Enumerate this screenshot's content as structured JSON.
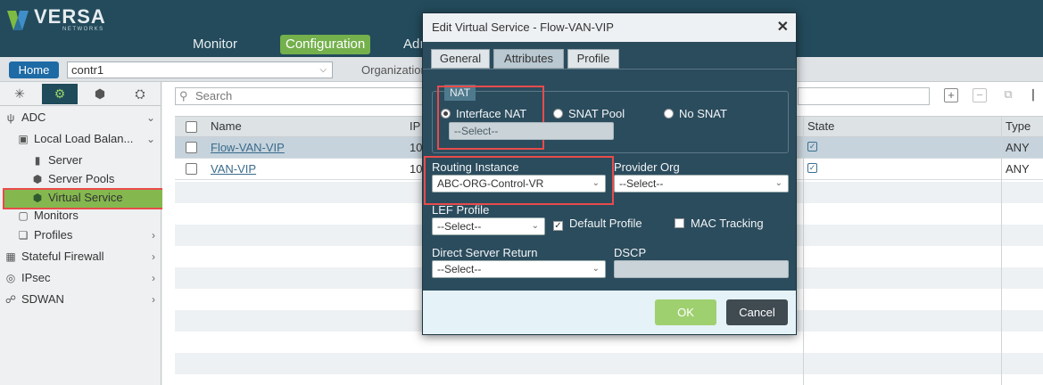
{
  "header": {
    "logo_text": "VERSA",
    "logo_sub": "NETWORKS",
    "nav": [
      "Monitor",
      "Configuration",
      "Adı"
    ]
  },
  "secbar": {
    "home": "Home",
    "org": "contr1",
    "org_label": "Organization"
  },
  "sidebar": {
    "items": [
      {
        "label": "ADC"
      },
      {
        "label": "Local Load Balan..."
      },
      {
        "label": "Server"
      },
      {
        "label": "Server Pools"
      },
      {
        "label": "Virtual Service"
      },
      {
        "label": "Monitors"
      },
      {
        "label": "Profiles"
      },
      {
        "label": "Stateful Firewall"
      },
      {
        "label": "IPsec"
      },
      {
        "label": "SDWAN"
      }
    ]
  },
  "list": {
    "search_placeholder": "Search",
    "columns": [
      "Name",
      "IP",
      "State",
      "Type"
    ],
    "rows": [
      {
        "name": "Flow-VAN-VIP",
        "ip": "10",
        "type": "ANY"
      },
      {
        "name": "VAN-VIP",
        "ip": "10",
        "type": "ANY"
      }
    ]
  },
  "dialog": {
    "title": "Edit Virtual Service - Flow-VAN-VIP",
    "tabs": [
      "General",
      "Attributes",
      "Profile"
    ],
    "nat": {
      "legend": "NAT",
      "options": [
        "Interface NAT",
        "SNAT Pool",
        "No SNAT"
      ],
      "select_placeholder": "--Select--"
    },
    "routing_instance_label": "Routing Instance",
    "routing_instance_value": "ABC-ORG-Control-VR",
    "provider_org_label": "Provider Org",
    "provider_org_value": "--Select--",
    "lef_profile_label": "LEF Profile",
    "lef_profile_value": "--Select--",
    "default_profile_label": "Default Profile",
    "mac_tracking_label": "MAC Tracking",
    "dsr_label": "Direct Server Return",
    "dsr_value": "--Select--",
    "dscp_label": "DSCP",
    "ok": "OK",
    "cancel": "Cancel"
  },
  "colors": {
    "header_bg": "#234b5c",
    "accent_green": "#74b04c",
    "dialog_bg": "#2b4c5d",
    "highlight_red": "#e94b4b"
  }
}
